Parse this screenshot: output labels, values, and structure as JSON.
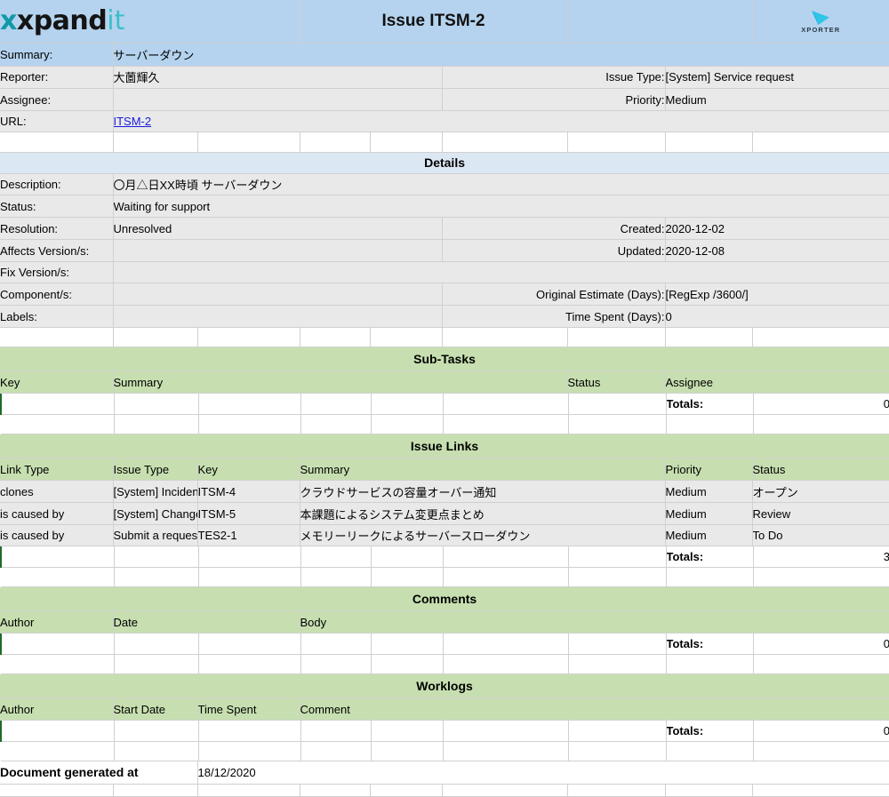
{
  "brand": {
    "logo_text_main": "xpand",
    "logo_text_accent": "it",
    "xporter_label": "XPORTER",
    "accent_teal": "#3bbfc9",
    "header_blue": "#b5d3ee",
    "section_green": "#c7dfb0",
    "body_gray": "#e9e9e9"
  },
  "header": {
    "title": "Issue ITSM-2",
    "summary_label": "Summary:",
    "summary_value": "サーバーダウン",
    "reporter_label": "Reporter:",
    "reporter_value": "大薗輝久",
    "assignee_label": "Assignee:",
    "assignee_value": "",
    "url_label": "URL:",
    "url_value": "ITSM-2",
    "issue_type_label": "Issue Type:",
    "issue_type_value": "[System] Service request",
    "priority_label": "Priority:",
    "priority_value": "Medium"
  },
  "details": {
    "section_title": "Details",
    "description_label": "Description:",
    "description_value": "〇月△日XX時頃 サーバーダウン",
    "status_label": "Status:",
    "status_value": "Waiting for support",
    "resolution_label": "Resolution:",
    "resolution_value": "Unresolved",
    "affects_version_label": "Affects Version/s:",
    "affects_version_value": "",
    "fix_version_label": "Fix Version/s:",
    "fix_version_value": "",
    "component_label": "Component/s:",
    "component_value": "",
    "labels_label": "Labels:",
    "labels_value": "",
    "created_label": "Created:",
    "created_value": "2020-12-02",
    "updated_label": "Updated:",
    "updated_value": "2020-12-08",
    "original_estimate_label": "Original Estimate (Days):",
    "original_estimate_value": "[RegExp /3600/]",
    "time_spent_label": "Time Spent (Days):",
    "time_spent_value": "0"
  },
  "subtasks": {
    "section_title": "Sub-Tasks",
    "columns": [
      "Key",
      "Summary",
      "Status",
      "Assignee"
    ],
    "rows": [],
    "totals_label": "Totals:",
    "totals_value": "0"
  },
  "issue_links": {
    "section_title": "Issue Links",
    "columns": [
      "Link Type",
      "Issue Type",
      "Key",
      "Summary",
      "Priority",
      "Status"
    ],
    "rows": [
      {
        "link_type": "clones",
        "issue_type": "[System] Incident",
        "key": "ITSM-4",
        "summary": "クラウドサービスの容量オーバー通知",
        "priority": "Medium",
        "status": "オープン"
      },
      {
        "link_type": "is caused by",
        "issue_type": "[System] Change",
        "key": "ITSM-5",
        "summary": "本課題によるシステム変更点まとめ",
        "priority": "Medium",
        "status": "Review"
      },
      {
        "link_type": "is caused by",
        "issue_type": "Submit a request or incident",
        "key": "TES2-1",
        "summary": "メモリーリークによるサーバースローダウン",
        "priority": "Medium",
        "status": "To Do"
      }
    ],
    "totals_label": "Totals:",
    "totals_value": "3"
  },
  "comments": {
    "section_title": "Comments",
    "columns": [
      "Author",
      "Date",
      "Body"
    ],
    "rows": [],
    "totals_label": "Totals:",
    "totals_value": "0"
  },
  "worklogs": {
    "section_title": "Worklogs",
    "columns": [
      "Author",
      "Start Date",
      "Time Spent",
      "Comment"
    ],
    "rows": [],
    "totals_label": "Totals:",
    "totals_value": "0"
  },
  "footer": {
    "generated_label": "Document generated at",
    "generated_value": "18/12/2020"
  }
}
